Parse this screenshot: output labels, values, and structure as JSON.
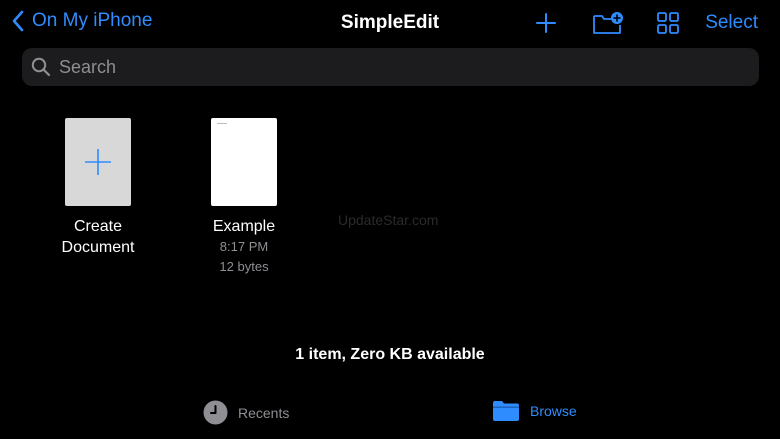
{
  "nav": {
    "back_label": "On My iPhone",
    "title": "SimpleEdit",
    "select_label": "Select"
  },
  "search": {
    "placeholder": "Search"
  },
  "items": [
    {
      "name_line1": "Create",
      "name_line2": "Document",
      "icon": "plus-icon"
    },
    {
      "name": "Example",
      "time": "8:17 PM",
      "size": "12 bytes"
    }
  ],
  "watermark": "UpdateStar.com",
  "status": "1 item, Zero KB available",
  "tabs": [
    {
      "label": "Recents",
      "icon": "clock-icon",
      "active": false
    },
    {
      "label": "Browse",
      "icon": "folder-icon",
      "active": true
    }
  ],
  "colors": {
    "accent": "#2f8cff",
    "background": "#000000",
    "secondary_text": "#8e8e93"
  }
}
